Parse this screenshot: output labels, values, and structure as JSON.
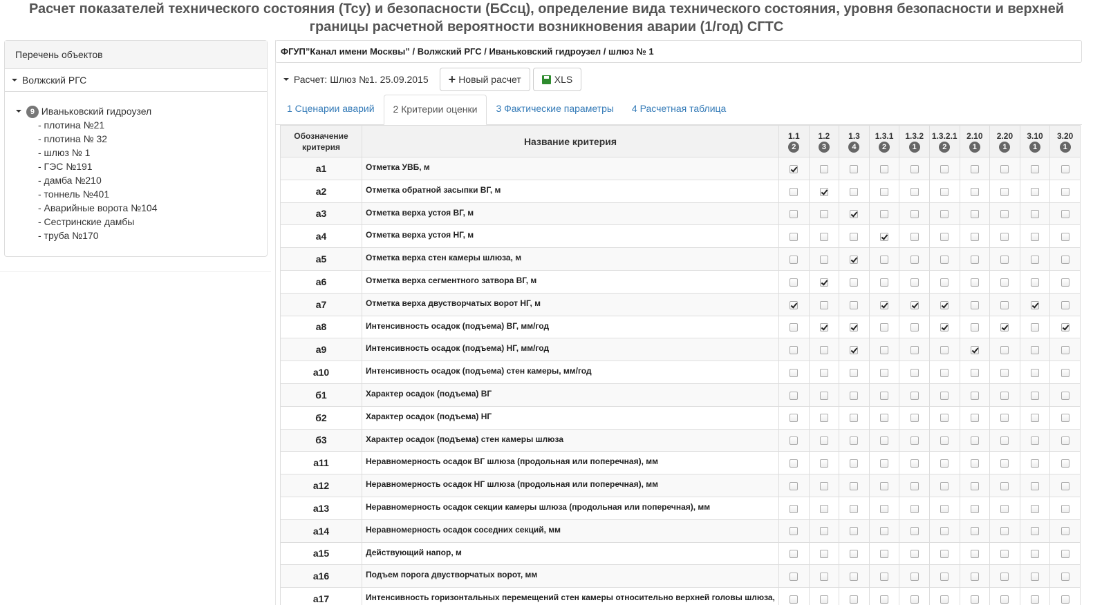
{
  "page": {
    "title": "Расчет показателей технического состояния (Тсу) и безопасности (БСсц), определение вида технического состояния, уровня безопасности и верхней границы расчетной вероятности возникновения аварии (1/год) СГТС"
  },
  "sidebar": {
    "heading": "Перечень объектов",
    "group": "Волжский РГС",
    "root": {
      "badge": "9",
      "label": "Иваньковский гидроузел"
    },
    "items": [
      "- плотина №21",
      "- плотина № 32",
      "- шлюз № 1",
      "- ГЭС №191",
      "- дамба №210",
      "- тоннель №401",
      "- Аварийные ворота №104",
      "- Сестринские дамбы",
      "- труба №170"
    ]
  },
  "main": {
    "breadcrumb": "ФГУП”Канал имени Москвы” / Волжский РГС / Иваньковский гидроузел / шлюз № 1",
    "calc_dropdown": "Расчет: Шлюз №1. 25.09.2015",
    "new_calc_label": "Новый расчет",
    "xls_label": "XLS",
    "tabs": [
      {
        "label": "1 Сценарии аварий",
        "active": false
      },
      {
        "label": "2 Критерии оценки",
        "active": true
      },
      {
        "label": "3 Фактические параметры",
        "active": false
      },
      {
        "label": "4 Расчетная таблица",
        "active": false
      }
    ]
  },
  "table": {
    "col_code": "Обозначение критерия",
    "col_name": "Название критерия",
    "categories": [
      {
        "num": "1.1",
        "count": "2"
      },
      {
        "num": "1.2",
        "count": "3"
      },
      {
        "num": "1.3",
        "count": "4"
      },
      {
        "num": "1.3.1",
        "count": "2"
      },
      {
        "num": "1.3.2",
        "count": "1"
      },
      {
        "num": "1.3.2.1",
        "count": "2"
      },
      {
        "num": "2.10",
        "count": "1"
      },
      {
        "num": "2.20",
        "count": "1"
      },
      {
        "num": "3.10",
        "count": "1"
      },
      {
        "num": "3.20",
        "count": "1"
      }
    ],
    "rows": [
      {
        "code": "а1",
        "name": "Отметка УВБ, м",
        "checks": [
          1,
          0,
          0,
          0,
          0,
          0,
          0,
          0,
          0,
          0
        ]
      },
      {
        "code": "а2",
        "name": "Отметка обратной засыпки ВГ, м",
        "checks": [
          0,
          1,
          0,
          0,
          0,
          0,
          0,
          0,
          0,
          0
        ]
      },
      {
        "code": "а3",
        "name": "Отметка верха устоя ВГ, м",
        "checks": [
          0,
          0,
          1,
          0,
          0,
          0,
          0,
          0,
          0,
          0
        ]
      },
      {
        "code": "а4",
        "name": "Отметка верха устоя НГ, м",
        "checks": [
          0,
          0,
          0,
          1,
          0,
          0,
          0,
          0,
          0,
          0
        ]
      },
      {
        "code": "а5",
        "name": "Отметка верха стен камеры шлюза, м",
        "checks": [
          0,
          0,
          1,
          0,
          0,
          0,
          0,
          0,
          0,
          0
        ]
      },
      {
        "code": "а6",
        "name": "Отметка верха сегментного затвора ВГ, м",
        "checks": [
          0,
          1,
          0,
          0,
          0,
          0,
          0,
          0,
          0,
          0
        ]
      },
      {
        "code": "а7",
        "name": "Отметка верха двустворчатых ворот НГ, м",
        "checks": [
          1,
          0,
          0,
          1,
          1,
          1,
          0,
          0,
          1,
          0
        ]
      },
      {
        "code": "а8",
        "name": "Интенсивность осадок (подъема) ВГ, мм/год",
        "checks": [
          0,
          1,
          1,
          0,
          0,
          1,
          0,
          1,
          0,
          1
        ]
      },
      {
        "code": "а9",
        "name": "Интенсивность осадок (подъема) НГ, мм/год",
        "checks": [
          0,
          0,
          1,
          0,
          0,
          0,
          1,
          0,
          0,
          0
        ]
      },
      {
        "code": "а10",
        "name": "Интенсивность осадок (подъема) стен камеры, мм/год",
        "checks": [
          0,
          0,
          0,
          0,
          0,
          0,
          0,
          0,
          0,
          0
        ]
      },
      {
        "code": "б1",
        "name": "Характер осадок (подъема) ВГ",
        "checks": [
          0,
          0,
          0,
          0,
          0,
          0,
          0,
          0,
          0,
          0
        ]
      },
      {
        "code": "б2",
        "name": "Характер осадок (подъема) НГ",
        "checks": [
          0,
          0,
          0,
          0,
          0,
          0,
          0,
          0,
          0,
          0
        ]
      },
      {
        "code": "б3",
        "name": "Характер осадок (подъема) стен камеры шлюза",
        "checks": [
          0,
          0,
          0,
          0,
          0,
          0,
          0,
          0,
          0,
          0
        ]
      },
      {
        "code": "а11",
        "name": "Неравномерность осадок ВГ шлюза (продольная или поперечная), мм",
        "checks": [
          0,
          0,
          0,
          0,
          0,
          0,
          0,
          0,
          0,
          0
        ]
      },
      {
        "code": "а12",
        "name": "Неравномерность осадок НГ шлюза (продольная или поперечная), мм",
        "checks": [
          0,
          0,
          0,
          0,
          0,
          0,
          0,
          0,
          0,
          0
        ]
      },
      {
        "code": "а13",
        "name": "Неравномерность осадок секции камеры шлюза (продольная или поперечная), мм",
        "checks": [
          0,
          0,
          0,
          0,
          0,
          0,
          0,
          0,
          0,
          0
        ]
      },
      {
        "code": "а14",
        "name": "Неравномерность осадок соседних секций, мм",
        "checks": [
          0,
          0,
          0,
          0,
          0,
          0,
          0,
          0,
          0,
          0
        ]
      },
      {
        "code": "а15",
        "name": "Действующий напор, м",
        "checks": [
          0,
          0,
          0,
          0,
          0,
          0,
          0,
          0,
          0,
          0
        ]
      },
      {
        "code": "а16",
        "name": "Подъем порога двустворчатых ворот, мм",
        "checks": [
          0,
          0,
          0,
          0,
          0,
          0,
          0,
          0,
          0,
          0
        ]
      },
      {
        "code": "а17",
        "name": "Интенсивность горизонтальных перемещений стен камеры относительно верхней головы шлюза,",
        "checks": [
          0,
          0,
          0,
          0,
          0,
          0,
          0,
          0,
          0,
          0
        ]
      }
    ]
  }
}
